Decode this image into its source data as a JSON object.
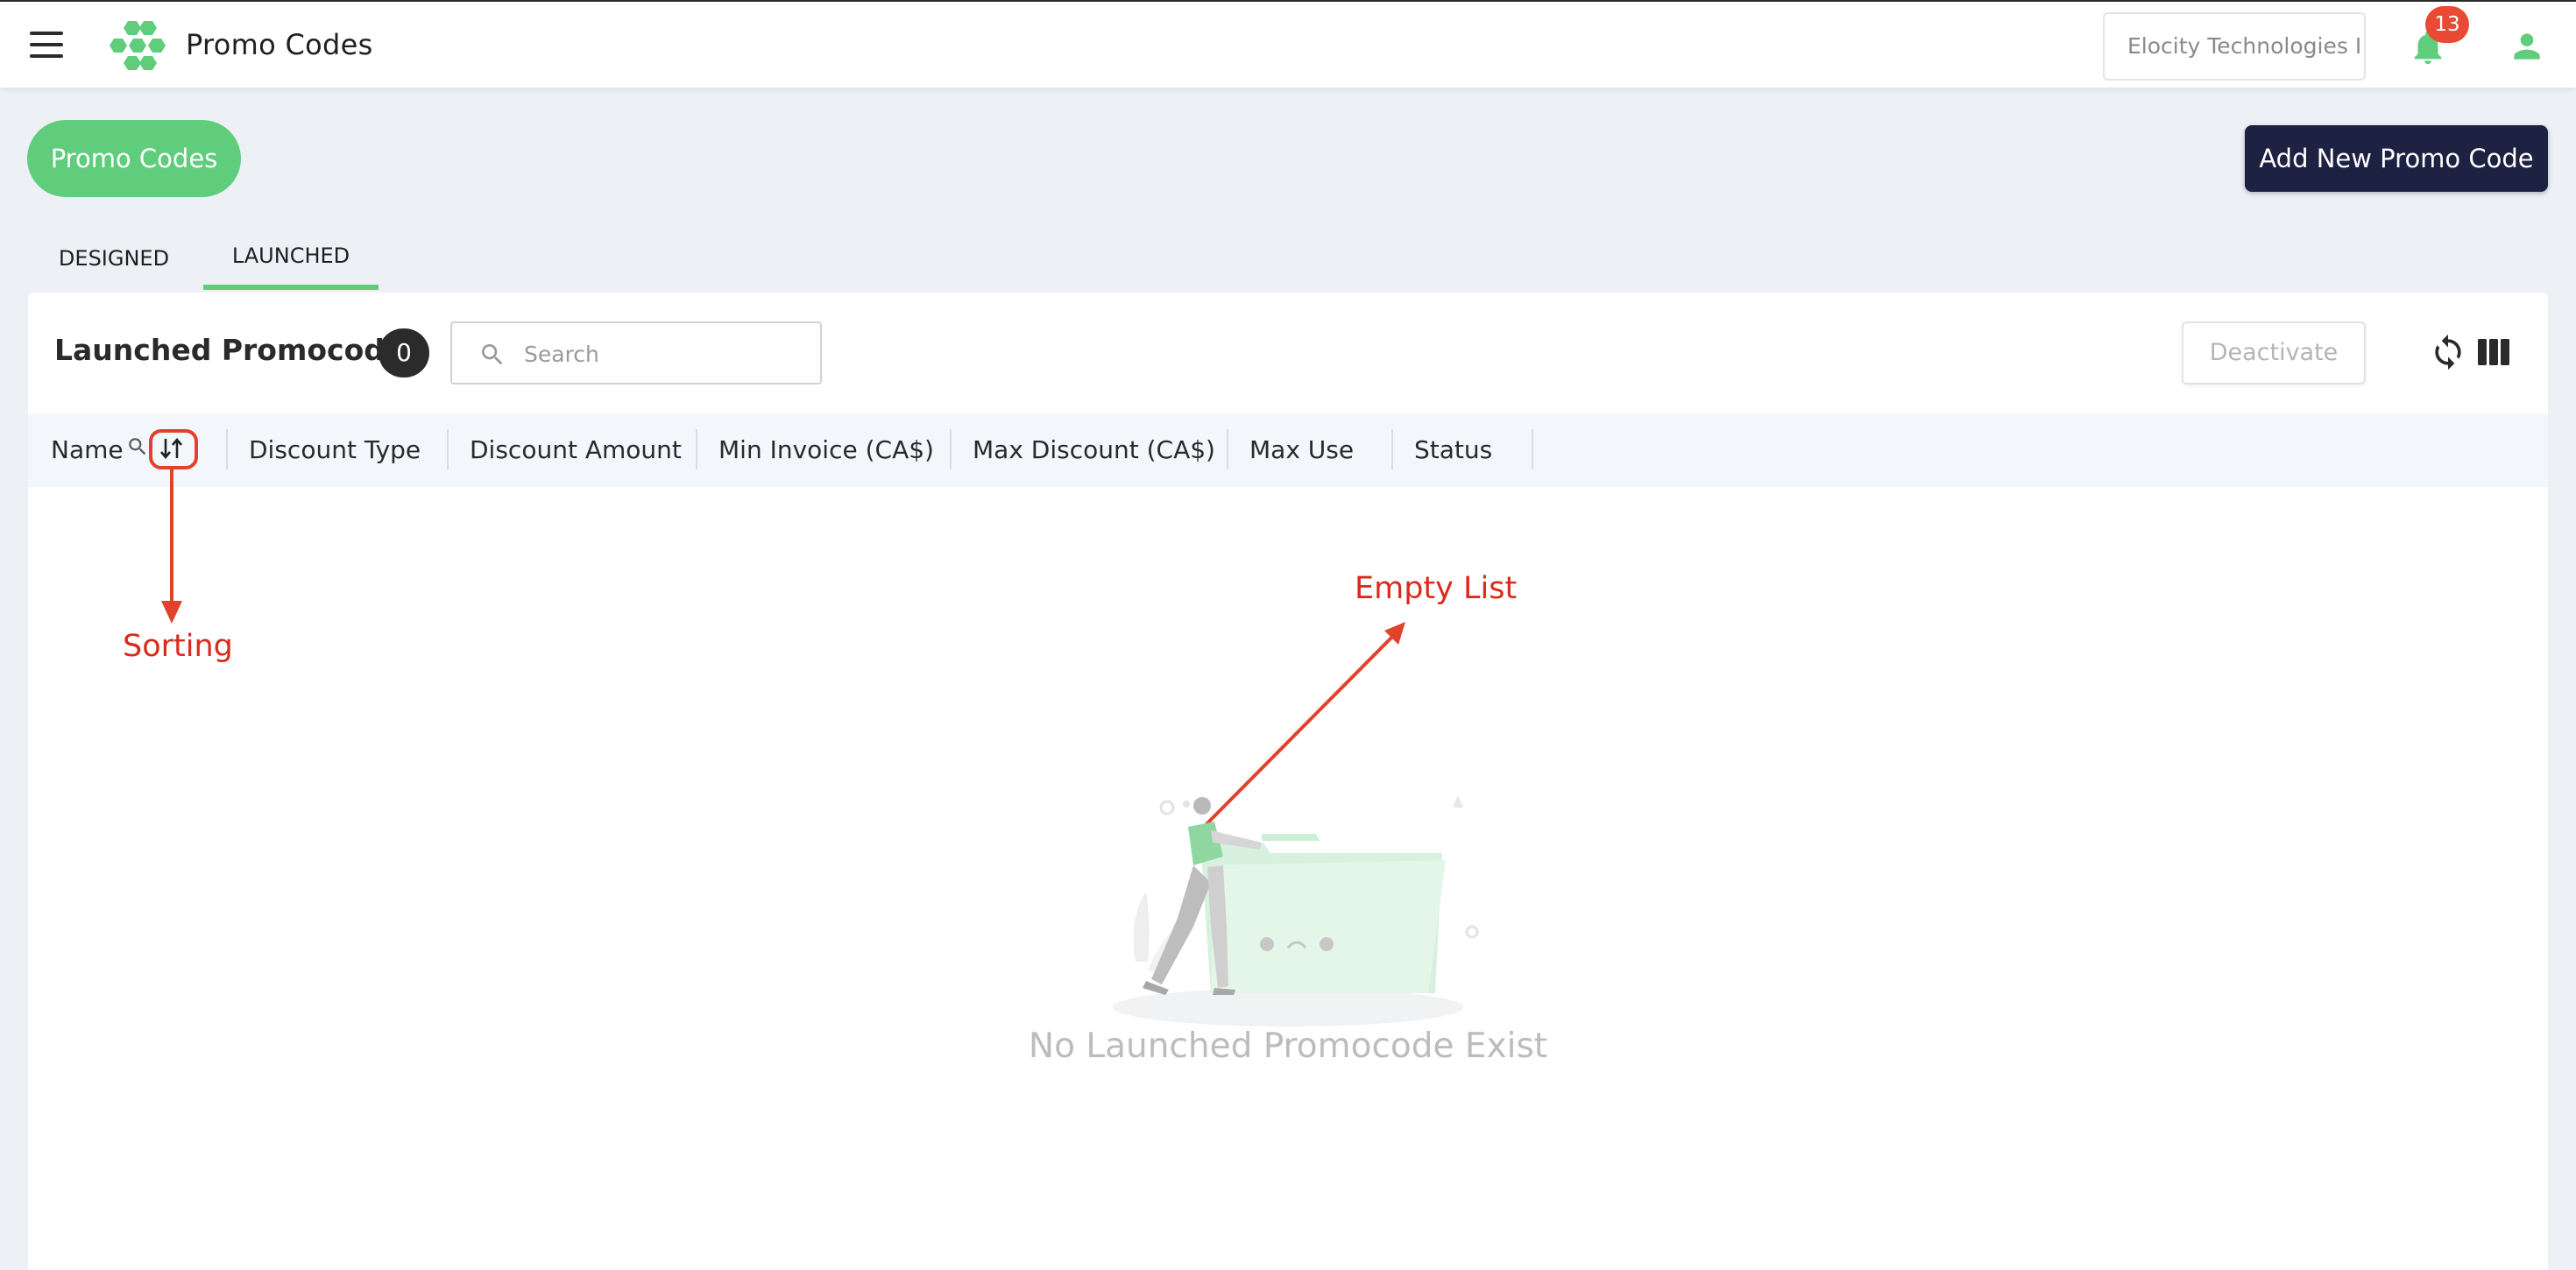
{
  "header": {
    "title": "Promo Codes",
    "organization": "Elocity Technologies I",
    "notification_count": "13"
  },
  "page": {
    "pill_title": "Promo Codes",
    "add_button": "Add New Promo Code",
    "tabs": [
      {
        "label": "DESIGNED",
        "active": false
      },
      {
        "label": "LAUNCHED",
        "active": true
      }
    ]
  },
  "list": {
    "title": "Launched Promocode",
    "count": "0",
    "search_placeholder": "Search",
    "deactivate_label": "Deactivate",
    "columns": [
      "Name",
      "Discount Type",
      "Discount Amount",
      "Min Invoice (CA$)",
      "Max Discount (CA$)",
      "Max Use",
      "Status"
    ],
    "empty_message": "No Launched Promocode Exist"
  },
  "annotations": {
    "sorting": "Sorting",
    "empty_list": "Empty List"
  },
  "colors": {
    "accent_green": "#5fcd7c",
    "primary_dark": "#1d2243",
    "badge_red": "#e84a33",
    "annotation_red": "#d92b1b"
  }
}
